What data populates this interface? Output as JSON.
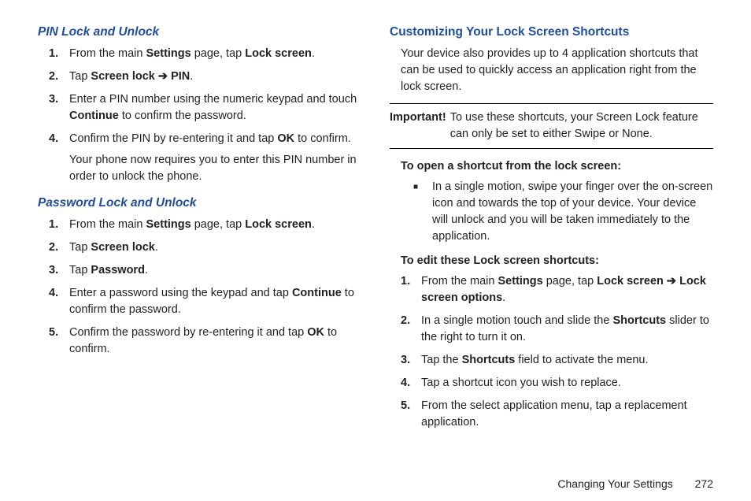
{
  "left": {
    "pin": {
      "heading": "PIN Lock and Unlock",
      "steps": [
        {
          "n": "1.",
          "parts": [
            "From the main ",
            "Settings",
            " page, tap ",
            "Lock screen",
            "."
          ]
        },
        {
          "n": "2.",
          "parts": [
            "Tap ",
            "Screen lock",
            " ",
            "➔",
            " ",
            "PIN",
            "."
          ]
        },
        {
          "n": "3.",
          "parts": [
            "Enter a PIN number using the numeric keypad and touch ",
            "Continue",
            " to confirm the password."
          ]
        },
        {
          "n": "4.",
          "parts": [
            "Confirm the PIN by re-entering it and tap ",
            "OK",
            " to confirm."
          ],
          "extra": "Your phone now requires you to enter this PIN number in order to unlock the phone."
        }
      ]
    },
    "pwd": {
      "heading": "Password Lock and Unlock",
      "steps": [
        {
          "n": "1.",
          "parts": [
            "From the main ",
            "Settings",
            " page, tap ",
            "Lock screen",
            "."
          ]
        },
        {
          "n": "2.",
          "parts": [
            "Tap ",
            "Screen lock",
            "."
          ]
        },
        {
          "n": "3.",
          "parts": [
            "Tap ",
            "Password",
            "."
          ]
        },
        {
          "n": "4.",
          "parts": [
            "Enter a password using the keypad and tap ",
            "Continue",
            " to confirm the password."
          ]
        },
        {
          "n": "5.",
          "parts": [
            "Confirm the password by re-entering it and tap ",
            "OK",
            " to confirm."
          ]
        }
      ]
    }
  },
  "right": {
    "heading": "Customizing Your Lock Screen Shortcuts",
    "intro": "Your device also provides up to 4 application shortcuts that can be used to quickly access an application right from the lock screen.",
    "important_label": "Important!",
    "important_text": "To use these shortcuts, your Screen Lock feature can only be set to either Swipe or None.",
    "open_heading": "To open a shortcut from the lock screen:",
    "open_bullet": "In a single motion, swipe your finger over the on-screen icon and towards the top of your device. Your device will unlock and you will be taken immediately to the application.",
    "edit_heading": "To edit these Lock screen shortcuts:",
    "edit_steps": [
      {
        "n": "1.",
        "parts": [
          "From the main ",
          "Settings",
          " page, tap ",
          "Lock screen",
          " ",
          "➔",
          " ",
          "Lock screen options",
          "."
        ]
      },
      {
        "n": "2.",
        "parts": [
          "In a single motion touch and slide the ",
          "Shortcuts",
          " slider to the right to turn it on."
        ]
      },
      {
        "n": "3.",
        "parts": [
          "Tap the ",
          "Shortcuts",
          " field to activate the menu."
        ]
      },
      {
        "n": "4.",
        "parts": [
          "Tap a shortcut icon you wish to replace."
        ]
      },
      {
        "n": "5.",
        "parts": [
          "From the select application menu, tap a replacement application."
        ]
      }
    ]
  },
  "footer": {
    "section": "Changing Your Settings",
    "page": "272"
  },
  "bold_words": [
    "Settings",
    "Lock screen",
    "Screen lock",
    "PIN",
    "Continue",
    "OK",
    "Password",
    "Lock screen options",
    "Shortcuts"
  ]
}
